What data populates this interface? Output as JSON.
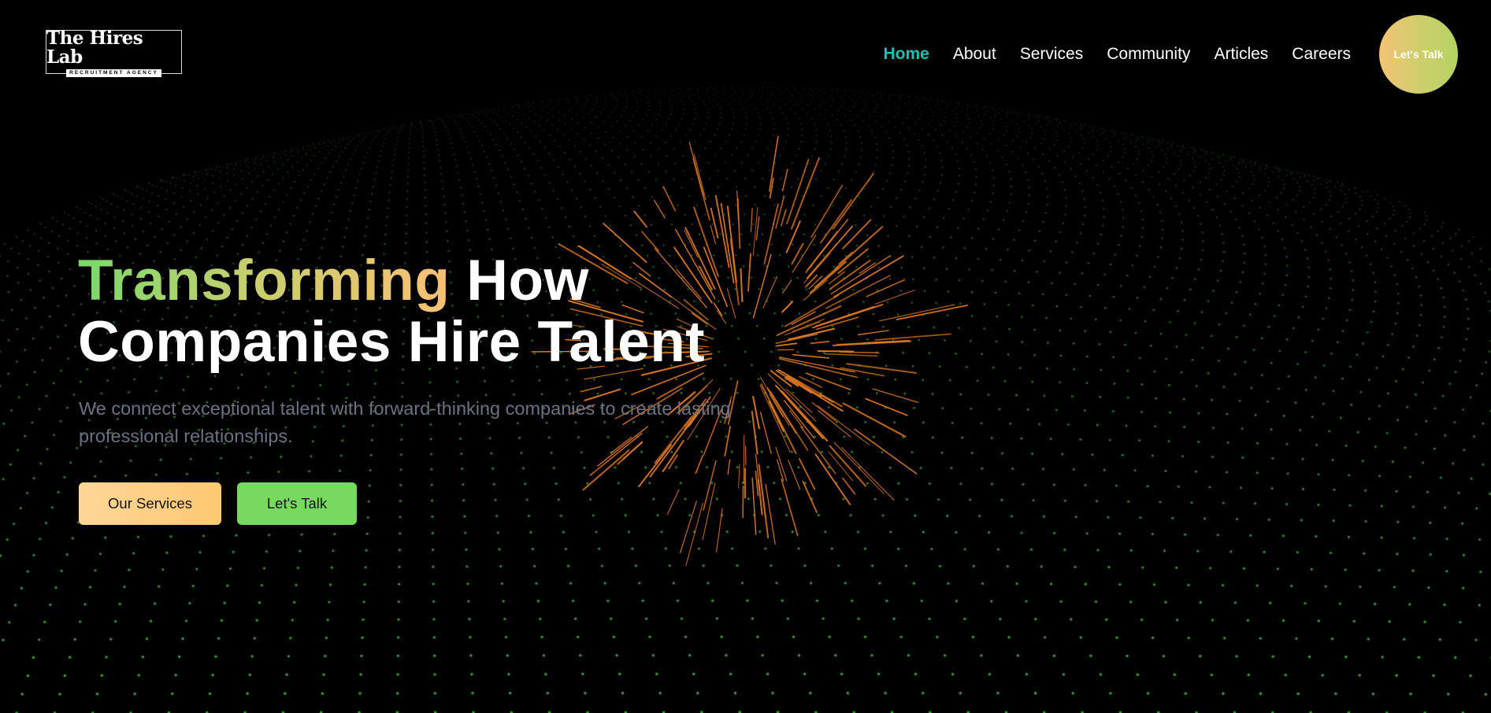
{
  "brand": {
    "name": "The Hires Lab",
    "tagline": "RECRUITMENT AGENCY"
  },
  "nav": {
    "items": [
      {
        "label": "Home",
        "active": true
      },
      {
        "label": "About",
        "active": false
      },
      {
        "label": "Services",
        "active": false
      },
      {
        "label": "Community",
        "active": false
      },
      {
        "label": "Articles",
        "active": false
      },
      {
        "label": "Careers",
        "active": false
      }
    ],
    "cta_label": "Let's Talk"
  },
  "hero": {
    "title_accent": "Transforming",
    "title_rest_line1": " How",
    "title_line2": "Companies Hire Talent",
    "subtitle": "We connect exceptional talent with forward-thinking companies to create lasting professional relationships.",
    "primary_button": "Our Services",
    "secondary_button": "Let's Talk"
  },
  "colors": {
    "background": "#000000",
    "nav_active": "#17c3b2",
    "dot_green": "#4fdc4a",
    "burst_orange": "#e07a20",
    "gradient_green": "#79d96b",
    "gradient_orange": "#f8c072",
    "subtitle_gray": "#6b7283"
  },
  "icons": {
    "background_decoration": "particle-burst-graphic"
  }
}
